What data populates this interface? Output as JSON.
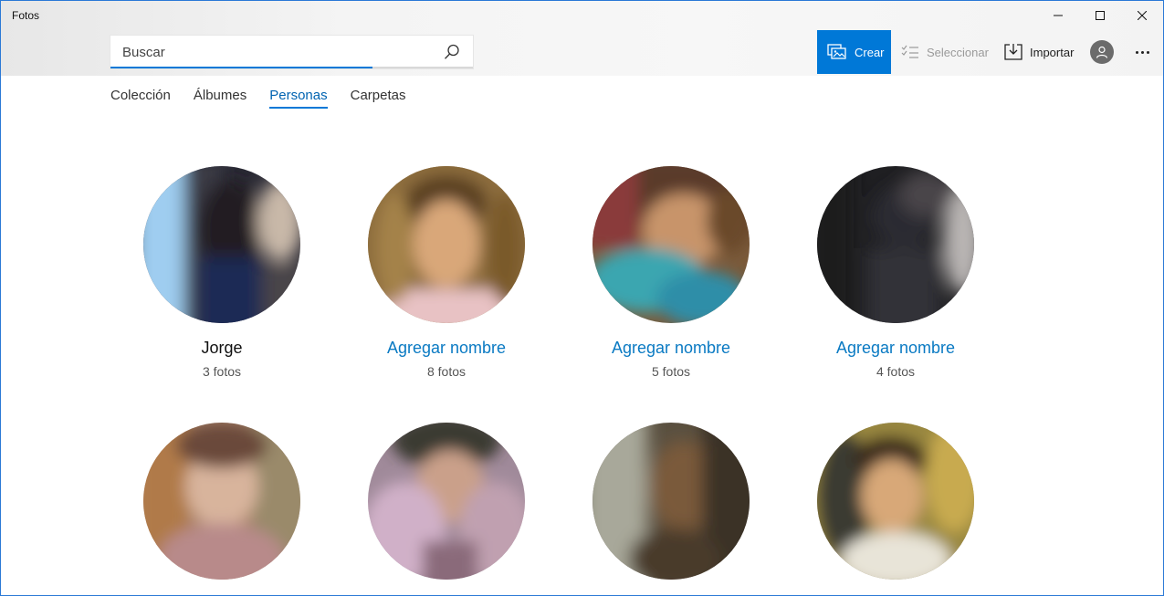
{
  "app": {
    "title": "Fotos"
  },
  "window_controls": {
    "minimize_icon": "minimize-icon",
    "maximize_icon": "maximize-icon",
    "close_icon": "close-icon"
  },
  "search": {
    "placeholder": "Buscar",
    "value": "",
    "icon": "search-icon"
  },
  "toolbar": {
    "create_label": "Crear",
    "select_label": "Seleccionar",
    "import_label": "Importar",
    "accent_color": "#0078d7"
  },
  "tabs": [
    {
      "label": "Colección",
      "active": false
    },
    {
      "label": "Álbumes",
      "active": false
    },
    {
      "label": "Personas",
      "active": true
    },
    {
      "label": "Carpetas",
      "active": false
    }
  ],
  "people": [
    {
      "name": "Jorge",
      "count": "3 fotos",
      "named": true
    },
    {
      "name": "Agregar nombre",
      "count": "8 fotos",
      "named": false
    },
    {
      "name": "Agregar nombre",
      "count": "5 fotos",
      "named": false
    },
    {
      "name": "Agregar nombre",
      "count": "4 fotos",
      "named": false
    },
    {
      "name": "",
      "count": "",
      "named": false
    },
    {
      "name": "",
      "count": "",
      "named": false
    },
    {
      "name": "",
      "count": "",
      "named": false
    },
    {
      "name": "",
      "count": "",
      "named": false
    }
  ]
}
